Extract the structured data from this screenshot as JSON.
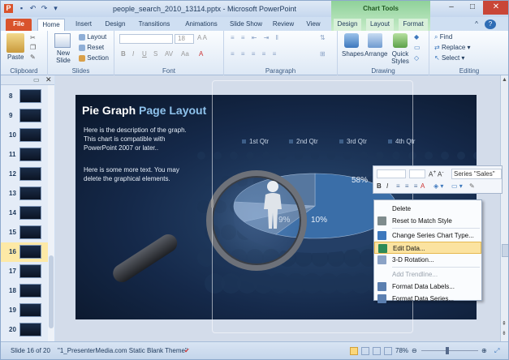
{
  "window": {
    "title": "people_search_2010_13114.pptx - Microsoft PowerPoint",
    "contextual_group": "Chart Tools"
  },
  "tabs": [
    "File",
    "Home",
    "Insert",
    "Design",
    "Transitions",
    "Animations",
    "Slide Show",
    "Review",
    "View",
    "Design",
    "Layout",
    "Format"
  ],
  "ribbon": {
    "clipboard": {
      "label": "Clipboard",
      "paste": "Paste"
    },
    "slides": {
      "label": "Slides",
      "new_slide": "New Slide",
      "layout": "Layout",
      "reset": "Reset",
      "section": "Section"
    },
    "font": {
      "label": "Font",
      "size": "18"
    },
    "paragraph": {
      "label": "Paragraph"
    },
    "drawing": {
      "label": "Drawing",
      "shapes": "Shapes",
      "arrange": "Arrange",
      "quick_styles": "Quick Styles"
    },
    "editing": {
      "label": "Editing",
      "find": "Find",
      "replace": "Replace",
      "select": "Select"
    }
  },
  "thumbnails": [
    8,
    9,
    10,
    11,
    12,
    13,
    14,
    15,
    16,
    17,
    18,
    19,
    20
  ],
  "selected_slide": 16,
  "slide": {
    "title_part1": "Pie Graph",
    "title_part2": "Page Layout",
    "body1": "Here is the description of the graph.  This chart is compatible with PowerPoint 2007 or later..",
    "body2": "Here is some more text.  You may delete the graphical elements.",
    "legend": [
      "1st Qtr",
      "2nd Qtr",
      "3rd Qtr",
      "4th Qtr"
    ],
    "pie_labels": [
      "58%",
      "9%",
      "10%"
    ]
  },
  "chart_data": {
    "type": "pie",
    "categories": [
      "1st Qtr",
      "2nd Qtr",
      "3rd Qtr",
      "4th Qtr"
    ],
    "values": [
      58,
      9,
      10,
      23
    ],
    "title": "",
    "legend": "top"
  },
  "mini_toolbar": {
    "series_value": "Series \"Sales\""
  },
  "context_menu": [
    {
      "label": "Delete",
      "enabled": true
    },
    {
      "label": "Reset to Match Style",
      "enabled": true
    },
    {
      "label": "Change Series Chart Type...",
      "enabled": true
    },
    {
      "label": "Edit Data...",
      "enabled": true,
      "highlighted": true
    },
    {
      "label": "3-D Rotation...",
      "enabled": true
    },
    {
      "label": "Add Trendline...",
      "enabled": false
    },
    {
      "label": "Format Data Labels...",
      "enabled": true
    },
    {
      "label": "Format Data Series...",
      "enabled": true
    }
  ],
  "status": {
    "slide": "Slide 16 of 20",
    "theme": "\"1_PresenterMedia.com Static Blank Theme\"",
    "zoom": "78%"
  }
}
